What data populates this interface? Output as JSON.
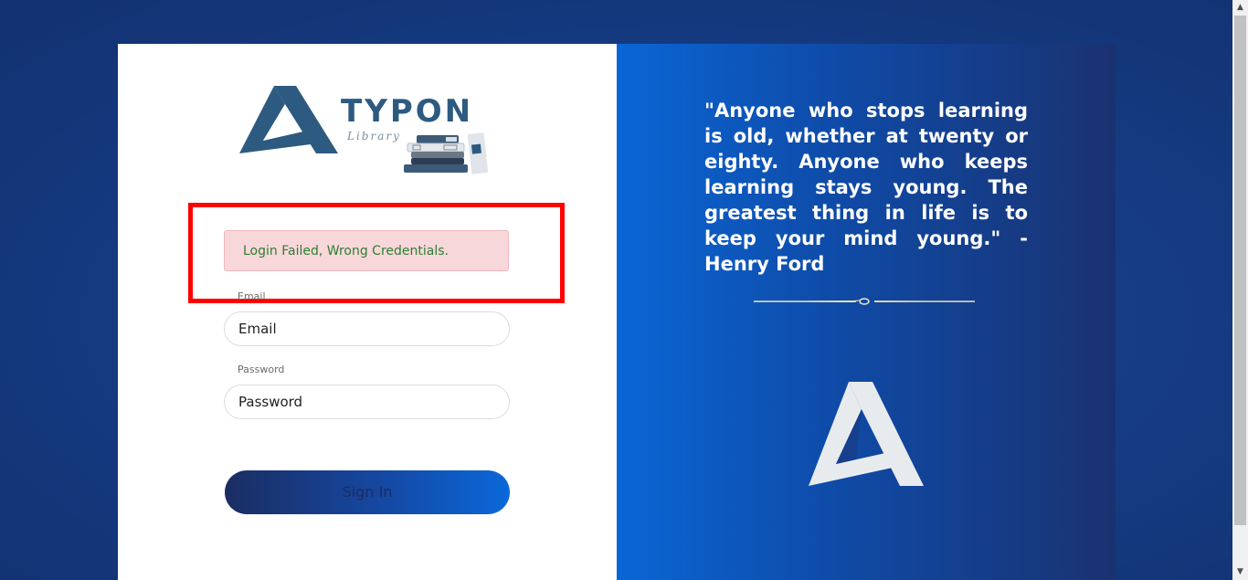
{
  "logo": {
    "brand": "TYPON",
    "subtitle": "Library"
  },
  "login": {
    "error_message": "Login Failed, Wrong Credentials.",
    "email_label": "Email",
    "email_placeholder": "Email",
    "password_label": "Password",
    "password_placeholder": "Password",
    "signin_label": "Sign In"
  },
  "quote": {
    "text": "\"Anyone who stops learning is old, whether at twenty or eighty. Anyone who keeps learning stays young. The greatest thing in life is to keep your mind young.\" -Henry Ford"
  },
  "colors": {
    "error_highlight": "#ff0000",
    "alert_bg": "#f8d7da",
    "alert_text": "#2e7d32",
    "brand": "#2d5a80"
  },
  "icons": {
    "brand_mark": "typon-a-logo-icon",
    "books": "books-stack-icon"
  }
}
